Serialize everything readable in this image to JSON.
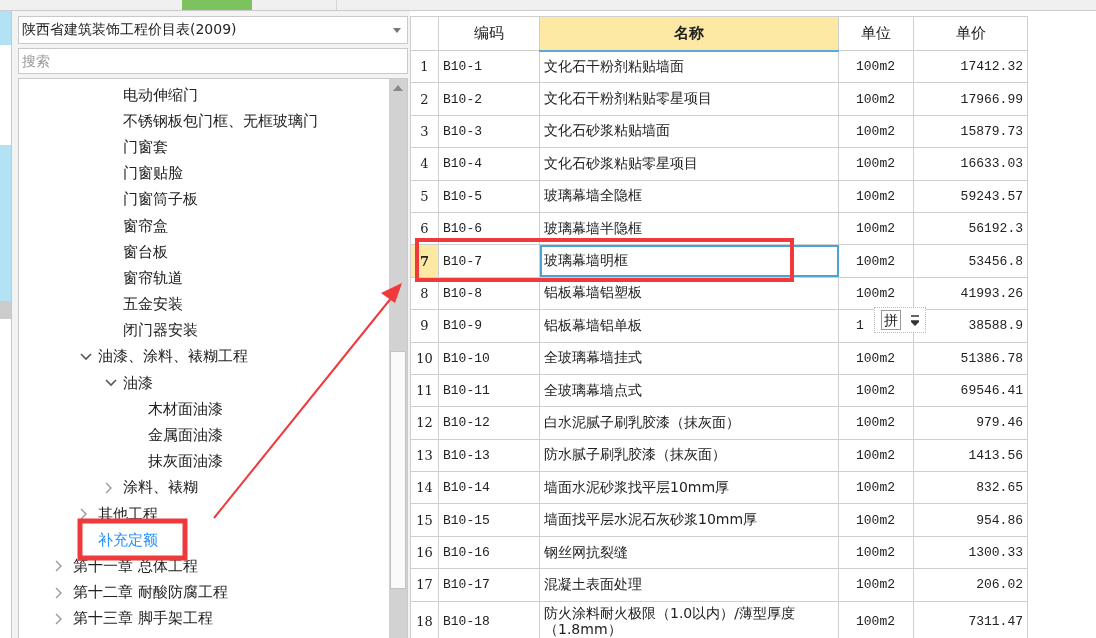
{
  "library_select": {
    "value": "陕西省建筑装饰工程价目表(2009)"
  },
  "search": {
    "placeholder": "搜索"
  },
  "tree": [
    {
      "children": [
        {
          "children": [
            {
              "label": "电动伸缩门",
              "selected": false
            },
            {
              "label": "不锈钢板包门框、无框玻璃门",
              "selected": false
            },
            {
              "label": "门窗套",
              "selected": false
            },
            {
              "label": "门窗贴脸",
              "selected": false
            },
            {
              "label": "门窗筒子板",
              "selected": false
            },
            {
              "label": "窗帘盒",
              "selected": false
            },
            {
              "label": "窗台板",
              "selected": false
            },
            {
              "label": "窗帘轨道",
              "selected": false
            },
            {
              "label": "五金安装",
              "selected": false
            },
            {
              "label": "闭门器安装",
              "selected": false
            }
          ]
        },
        {
          "label": "油漆、涂料、裱糊工程",
          "selected": false,
          "expanded": true,
          "children": [
            {
              "label": "油漆",
              "selected": false,
              "expanded": true,
              "children": [
                {
                  "label": "木材面油漆",
                  "selected": false
                },
                {
                  "label": "金属面油漆",
                  "selected": false
                },
                {
                  "label": "抹灰面油漆",
                  "selected": false
                }
              ]
            },
            {
              "label": "涂料、裱糊",
              "selected": false,
              "expanded": false
            }
          ]
        },
        {
          "label": "其他工程",
          "selected": false,
          "expanded": false
        },
        {
          "label": "补充定额",
          "selected": true
        }
      ]
    },
    {
      "label": "第十一章 总体工程",
      "selected": false,
      "expanded": false
    },
    {
      "label": "第十二章 耐酸防腐工程",
      "selected": false,
      "expanded": false
    },
    {
      "label": "第十三章 脚手架工程",
      "selected": false,
      "expanded": false
    }
  ],
  "table": {
    "columns": [
      {
        "label": "编码",
        "selected": false
      },
      {
        "label": "名称",
        "selected": true
      },
      {
        "label": "单位",
        "selected": false
      },
      {
        "label": "单价",
        "selected": false
      }
    ],
    "rows": [
      {
        "no": "1",
        "code": "B10-1",
        "name": "文化石干粉剂粘贴墙面",
        "unit": "100m2",
        "price": "17412.32",
        "selected": false
      },
      {
        "no": "2",
        "code": "B10-2",
        "name": "文化石干粉剂粘贴零星项目",
        "unit": "100m2",
        "price": "17966.99",
        "selected": false
      },
      {
        "no": "3",
        "code": "B10-3",
        "name": "文化石砂浆粘贴墙面",
        "unit": "100m2",
        "price": "15879.73",
        "selected": false
      },
      {
        "no": "4",
        "code": "B10-4",
        "name": "文化石砂浆粘贴零星项目",
        "unit": "100m2",
        "price": "16633.03",
        "selected": false
      },
      {
        "no": "5",
        "code": "B10-5",
        "name": "玻璃幕墙全隐框",
        "unit": "100m2",
        "price": "59243.57",
        "selected": false
      },
      {
        "no": "6",
        "code": "B10-6",
        "name": "玻璃幕墙半隐框",
        "unit": "100m2",
        "price": "56192.3",
        "selected": false
      },
      {
        "no": "7",
        "code": "B10-7",
        "name": "玻璃幕墙明框",
        "unit": "100m2",
        "price": "53456.8",
        "selected": true
      },
      {
        "no": "8",
        "code": "B10-8",
        "name": "铝板幕墙铝塑板",
        "unit": "100m2",
        "price": "41993.26",
        "selected": false
      },
      {
        "no": "9",
        "code": "B10-9",
        "name": "铝板幕墙铝单板",
        "unit": "1",
        "price": "38588.9",
        "selected": false
      },
      {
        "no": "10",
        "code": "B10-10",
        "name": "全玻璃幕墙挂式",
        "unit": "100m2",
        "price": "51386.78",
        "selected": false
      },
      {
        "no": "11",
        "code": "B10-11",
        "name": "全玻璃幕墙点式",
        "unit": "100m2",
        "price": "69546.41",
        "selected": false
      },
      {
        "no": "12",
        "code": "B10-12",
        "name": "白水泥腻子刷乳胶漆（抹灰面）",
        "unit": "100m2",
        "price": "979.46",
        "selected": false
      },
      {
        "no": "13",
        "code": "B10-13",
        "name": "防水腻子刷乳胶漆（抹灰面）",
        "unit": "100m2",
        "price": "1413.56",
        "selected": false
      },
      {
        "no": "14",
        "code": "B10-14",
        "name": "墙面水泥砂浆找平层10mm厚",
        "unit": "100m2",
        "price": "832.65",
        "selected": false
      },
      {
        "no": "15",
        "code": "B10-15",
        "name": "墙面找平层水泥石灰砂浆10mm厚",
        "unit": "100m2",
        "price": "954.86",
        "selected": false
      },
      {
        "no": "16",
        "code": "B10-16",
        "name": "钢丝网抗裂缝",
        "unit": "100m2",
        "price": "1300.33",
        "selected": false
      },
      {
        "no": "17",
        "code": "B10-17",
        "name": "混凝土表面处理",
        "unit": "100m2",
        "price": "206.02",
        "selected": false
      },
      {
        "no": "18",
        "code": "B10-18",
        "name": "防火涂料耐火极限（1.0以内）/薄型厚度（1.8mm）",
        "unit": "100m2",
        "price": "7311.47",
        "selected": false
      }
    ]
  },
  "ime_popup": {
    "label": "拼"
  }
}
